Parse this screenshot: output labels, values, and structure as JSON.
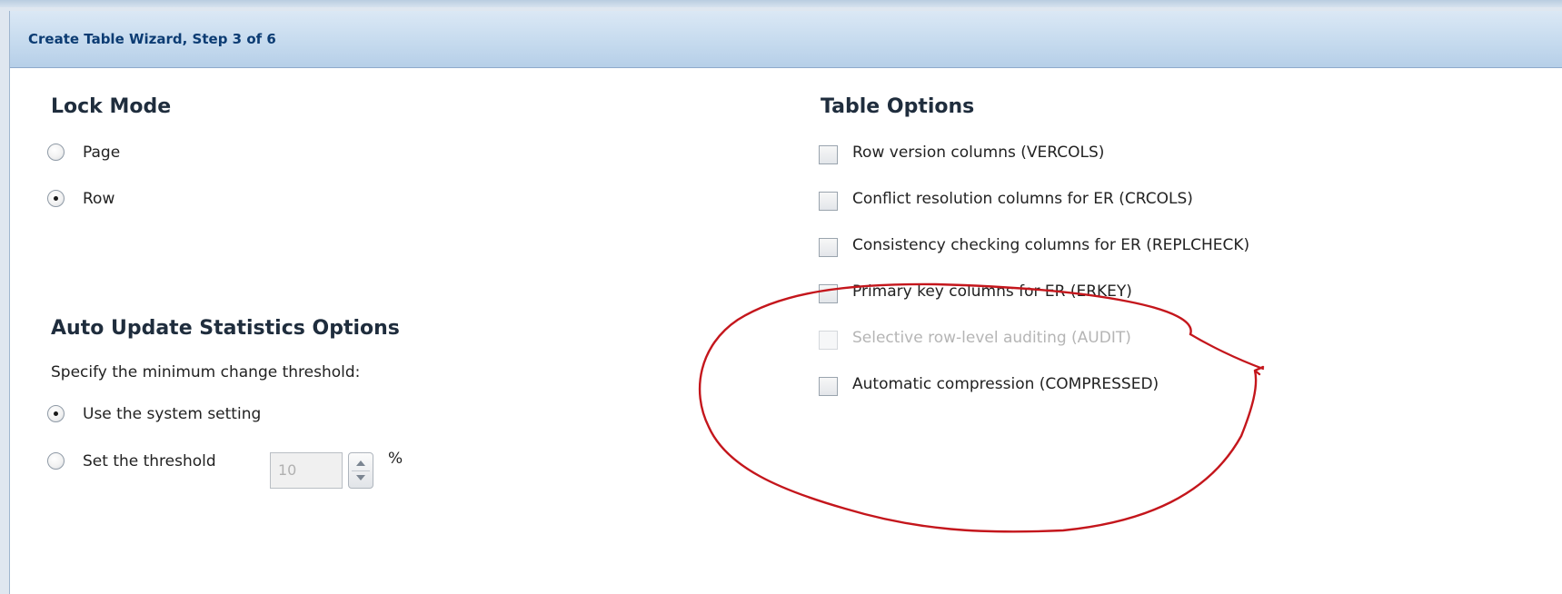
{
  "wizard": {
    "title": "Create Table Wizard, Step 3 of 6"
  },
  "lock_mode": {
    "heading": "Lock Mode",
    "options": [
      {
        "label": "Page",
        "selected": false
      },
      {
        "label": "Row",
        "selected": true
      }
    ]
  },
  "auto_update": {
    "heading": "Auto Update Statistics Options",
    "description": "Specify the minimum change threshold:",
    "options": [
      {
        "label": "Use the system setting",
        "selected": true
      },
      {
        "label": "Set the threshold",
        "selected": false
      }
    ],
    "threshold_value": "10",
    "threshold_unit": "%"
  },
  "table_options": {
    "heading": "Table Options",
    "items": [
      {
        "label": "Row version columns (VERCOLS)",
        "checked": false,
        "enabled": true
      },
      {
        "label": "Conflict resolution columns for ER (CRCOLS)",
        "checked": false,
        "enabled": true
      },
      {
        "label": "Consistency checking columns for ER (REPLCHECK)",
        "checked": false,
        "enabled": true
      },
      {
        "label": "Primary key columns for ER (ERKEY)",
        "checked": false,
        "enabled": true
      },
      {
        "label": "Selective row-level auditing (AUDIT)",
        "checked": false,
        "enabled": false
      },
      {
        "label": "Automatic compression (COMPRESSED)",
        "checked": false,
        "enabled": true
      }
    ]
  },
  "colors": {
    "title_text": "#0c3c73",
    "annotation": "#c4161c",
    "disabled_text": "#b5b5b5"
  }
}
